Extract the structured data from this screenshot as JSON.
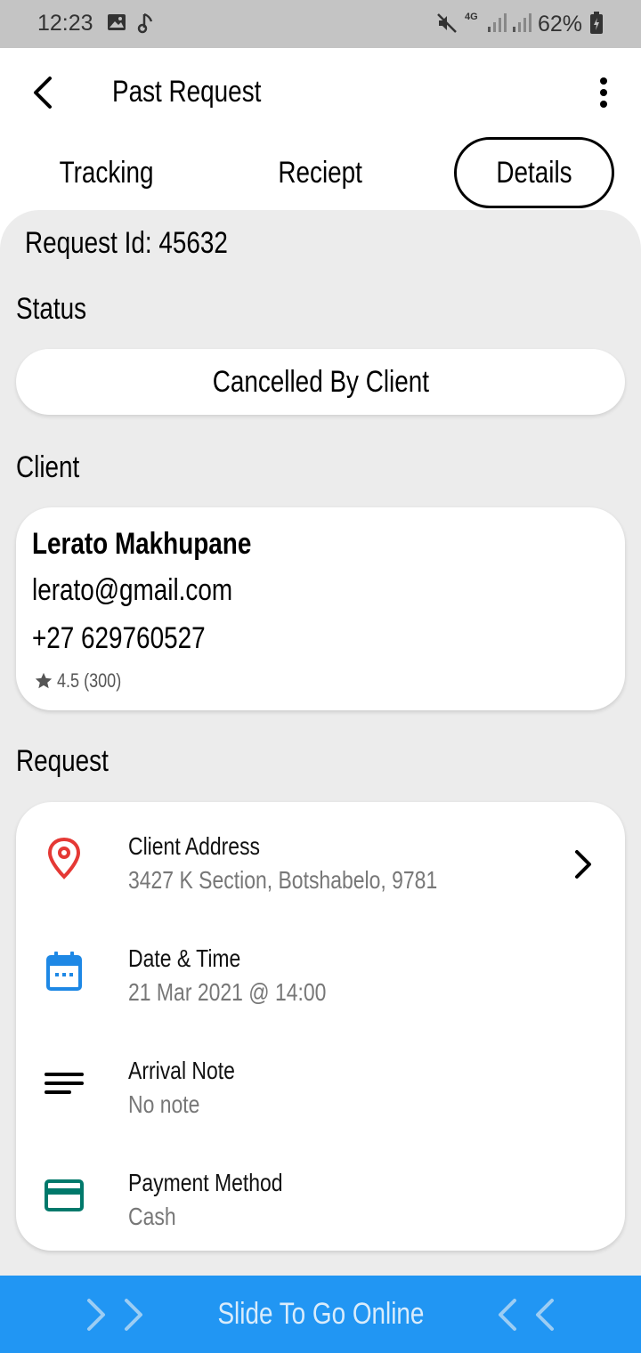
{
  "status_bar": {
    "time": "12:23",
    "network": "4G",
    "battery": "62%"
  },
  "app_bar": {
    "title": "Past Request",
    "back_icon": "chevron-left-icon",
    "menu_icon": "more-vertical-icon"
  },
  "tabs": [
    {
      "label": "Tracking",
      "active": false
    },
    {
      "label": "Reciept",
      "active": false
    },
    {
      "label": "Details",
      "active": true
    }
  ],
  "details": {
    "request_id": "Request Id: 45632",
    "status_label": "Status",
    "status_value": "Cancelled By Client",
    "client_label": "Client",
    "client": {
      "name": "Lerato Makhupane",
      "email": "lerato@gmail.com",
      "phone": "+27 629760527",
      "rating": "4.5 (300)"
    },
    "request_label": "Request",
    "request_items": [
      {
        "title": "Client Address",
        "value": "3427 K Section, Botshabelo, 9781",
        "icon": "location-pin-icon",
        "color": "#e53935"
      },
      {
        "title": "Date & Time",
        "value": "21 Mar 2021 @ 14:00",
        "icon": "calendar-icon",
        "color": "#1e88e5"
      },
      {
        "title": "Arrival Note",
        "value": "No note",
        "icon": "notes-icon",
        "color": "#000000"
      },
      {
        "title": "Payment Method",
        "value": "Cash",
        "icon": "credit-card-icon",
        "color": "#00796b"
      }
    ]
  },
  "slide_bar": {
    "label": "Slide To Go Online",
    "color": "#2196f3"
  }
}
